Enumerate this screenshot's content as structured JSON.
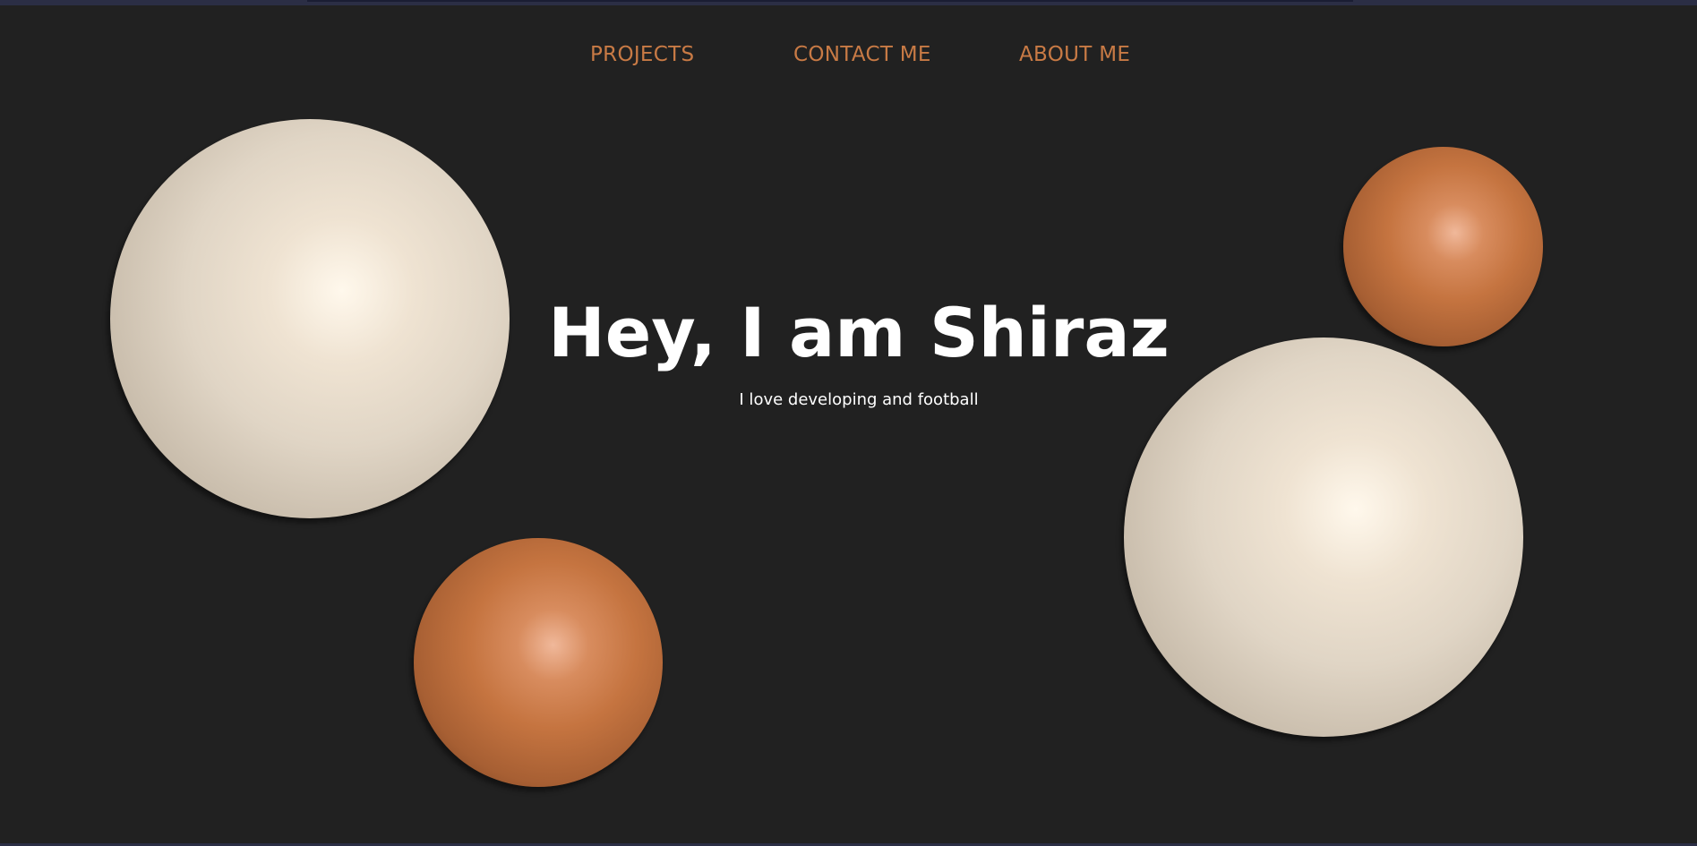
{
  "theme": {
    "background": "#212121",
    "accent": "#c87a45",
    "text": "#ffffff",
    "sphere_cream": "#e6dccd",
    "sphere_orange": "#c57440"
  },
  "nav": {
    "items": [
      {
        "label": "PROJECTS"
      },
      {
        "label": "CONTACT ME"
      },
      {
        "label": "ABOUT ME"
      }
    ]
  },
  "hero": {
    "title": "Hey, I am Shiraz",
    "subtitle": "I love developing and football"
  }
}
